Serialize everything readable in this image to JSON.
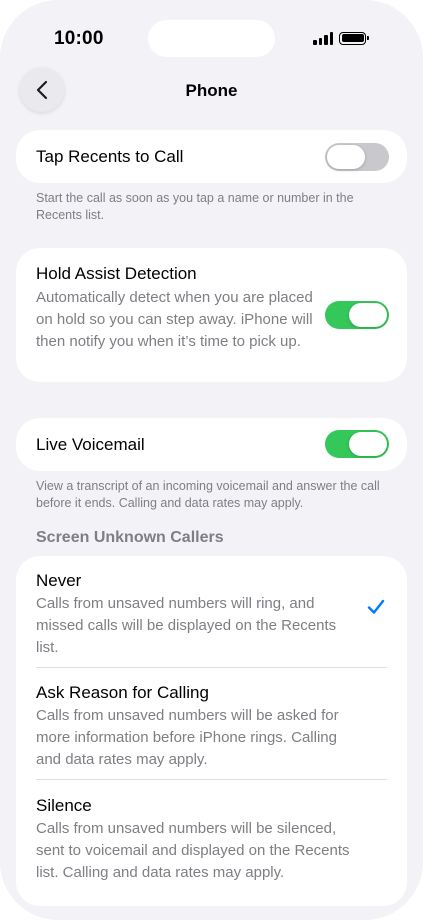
{
  "status_bar": {
    "time": "10:00"
  },
  "nav": {
    "title": "Phone"
  },
  "tap_recents": {
    "label": "Tap Recents to Call",
    "enabled": false,
    "footnote": "Start the call as soon as you tap a name or number in the Recents list."
  },
  "hold_assist": {
    "label": "Hold Assist Detection",
    "description": "Automatically detect when you are placed on hold so you can step away. iPhone will then notify you when it’s time to pick up.",
    "enabled": true
  },
  "live_voicemail": {
    "label": "Live Voicemail",
    "enabled": true,
    "footnote": "View a transcript of an incoming voicemail and answer the call before it ends. Calling and data rates may apply."
  },
  "screen_unknown": {
    "header": "Screen Unknown Callers",
    "options": [
      {
        "label": "Never",
        "description": "Calls from unsaved numbers will ring, and missed calls will be displayed on the Recents list.",
        "selected": true
      },
      {
        "label": "Ask Reason for Calling",
        "description": "Calls from unsaved numbers will be asked for more information before iPhone rings. Calling and data rates may apply.",
        "selected": false
      },
      {
        "label": "Silence",
        "description": "Calls from unsaved numbers will be silenced, sent to voicemail and displayed on the Recents list. Calling and data rates may apply.",
        "selected": false
      }
    ]
  },
  "colors": {
    "accent": "#007aff",
    "toggle_on": "#34c759",
    "toggle_off": "#c9c9cd",
    "background": "#f2f2f7",
    "secondary_text": "#7e7e84"
  }
}
